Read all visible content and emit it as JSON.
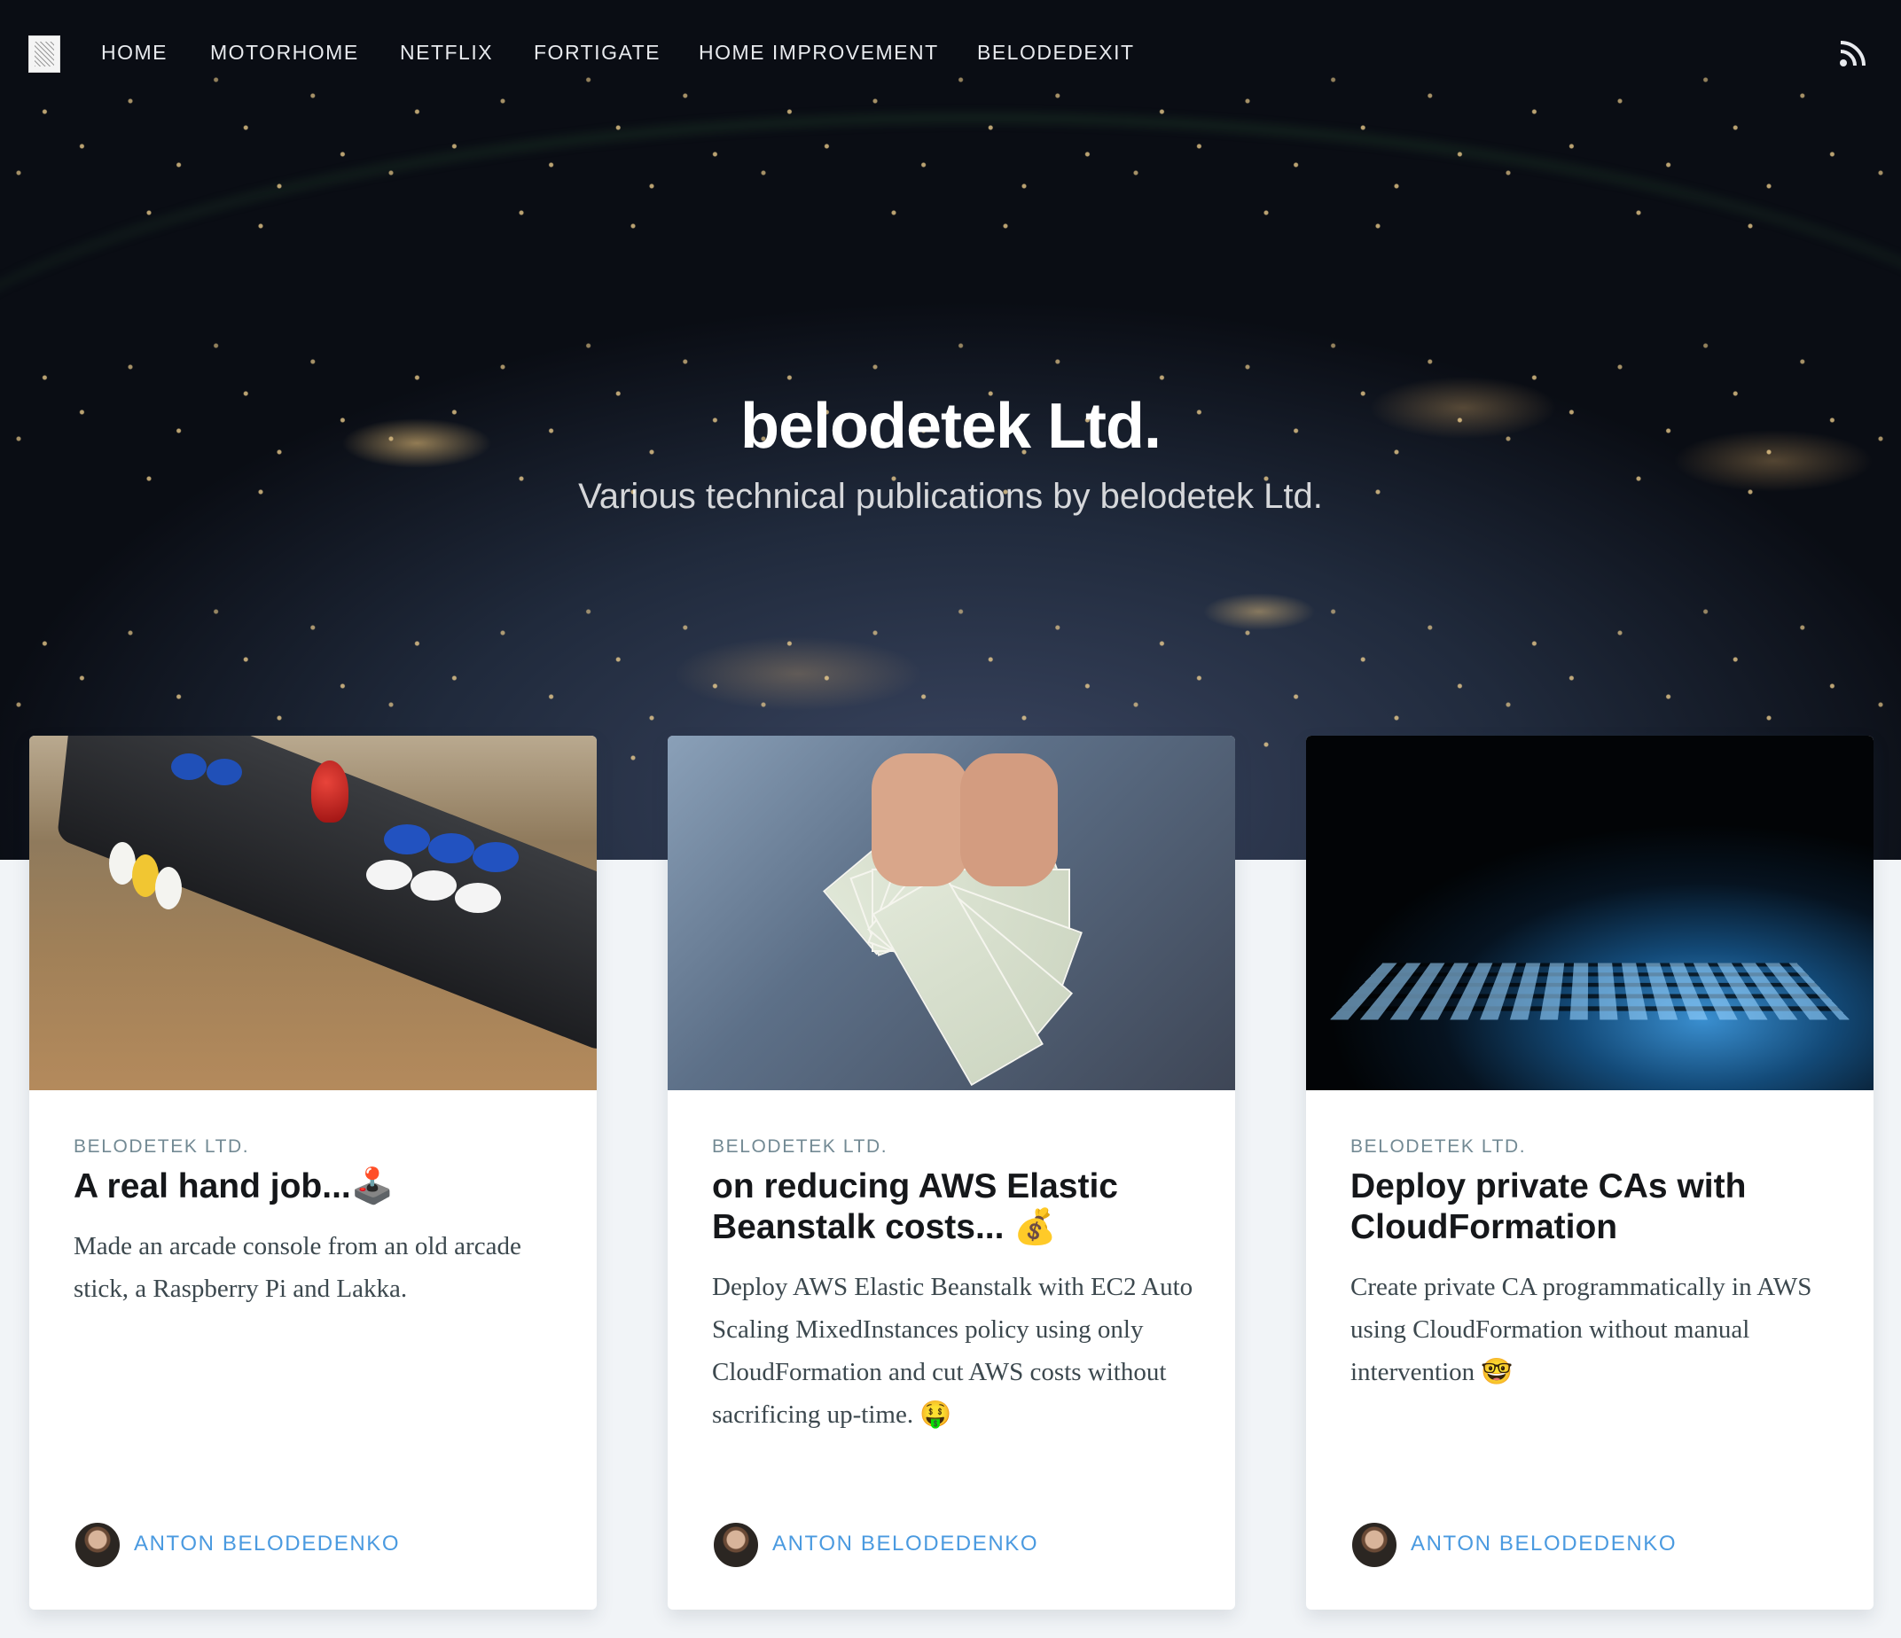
{
  "nav": {
    "items": [
      "HOME",
      "MOTORHOME",
      "NETFLIX",
      "FORTIGATE",
      "HOME IMPROVEMENT",
      "BELODEDEXIT"
    ]
  },
  "site": {
    "title": "belodetek Ltd.",
    "description": "Various technical publications by belodetek Ltd."
  },
  "posts": [
    {
      "tag": "BELODETEK LTD.",
      "title": "A real hand job...🕹️",
      "excerpt": "Made an arcade console from an old arcade stick, a Raspberry Pi and Lakka.",
      "author": "ANTON BELODEDENKO"
    },
    {
      "tag": "BELODETEK LTD.",
      "title": "on reducing AWS Elastic Beanstalk costs... 💰",
      "excerpt": "Deploy AWS Elastic Beanstalk with EC2 Auto Scaling MixedInstances policy using only CloudFormation and cut AWS costs without sacrificing up-time. 🤑",
      "author": "ANTON BELODEDENKO"
    },
    {
      "tag": "BELODETEK LTD.",
      "title": "Deploy private CAs with CloudFormation",
      "excerpt": "Create private CA programmatically in AWS using CloudFormation without manual intervention 🤓",
      "author": "ANTON BELODEDENKO"
    }
  ],
  "icons": {
    "logo": "site-logo",
    "rss": "rss-icon"
  }
}
